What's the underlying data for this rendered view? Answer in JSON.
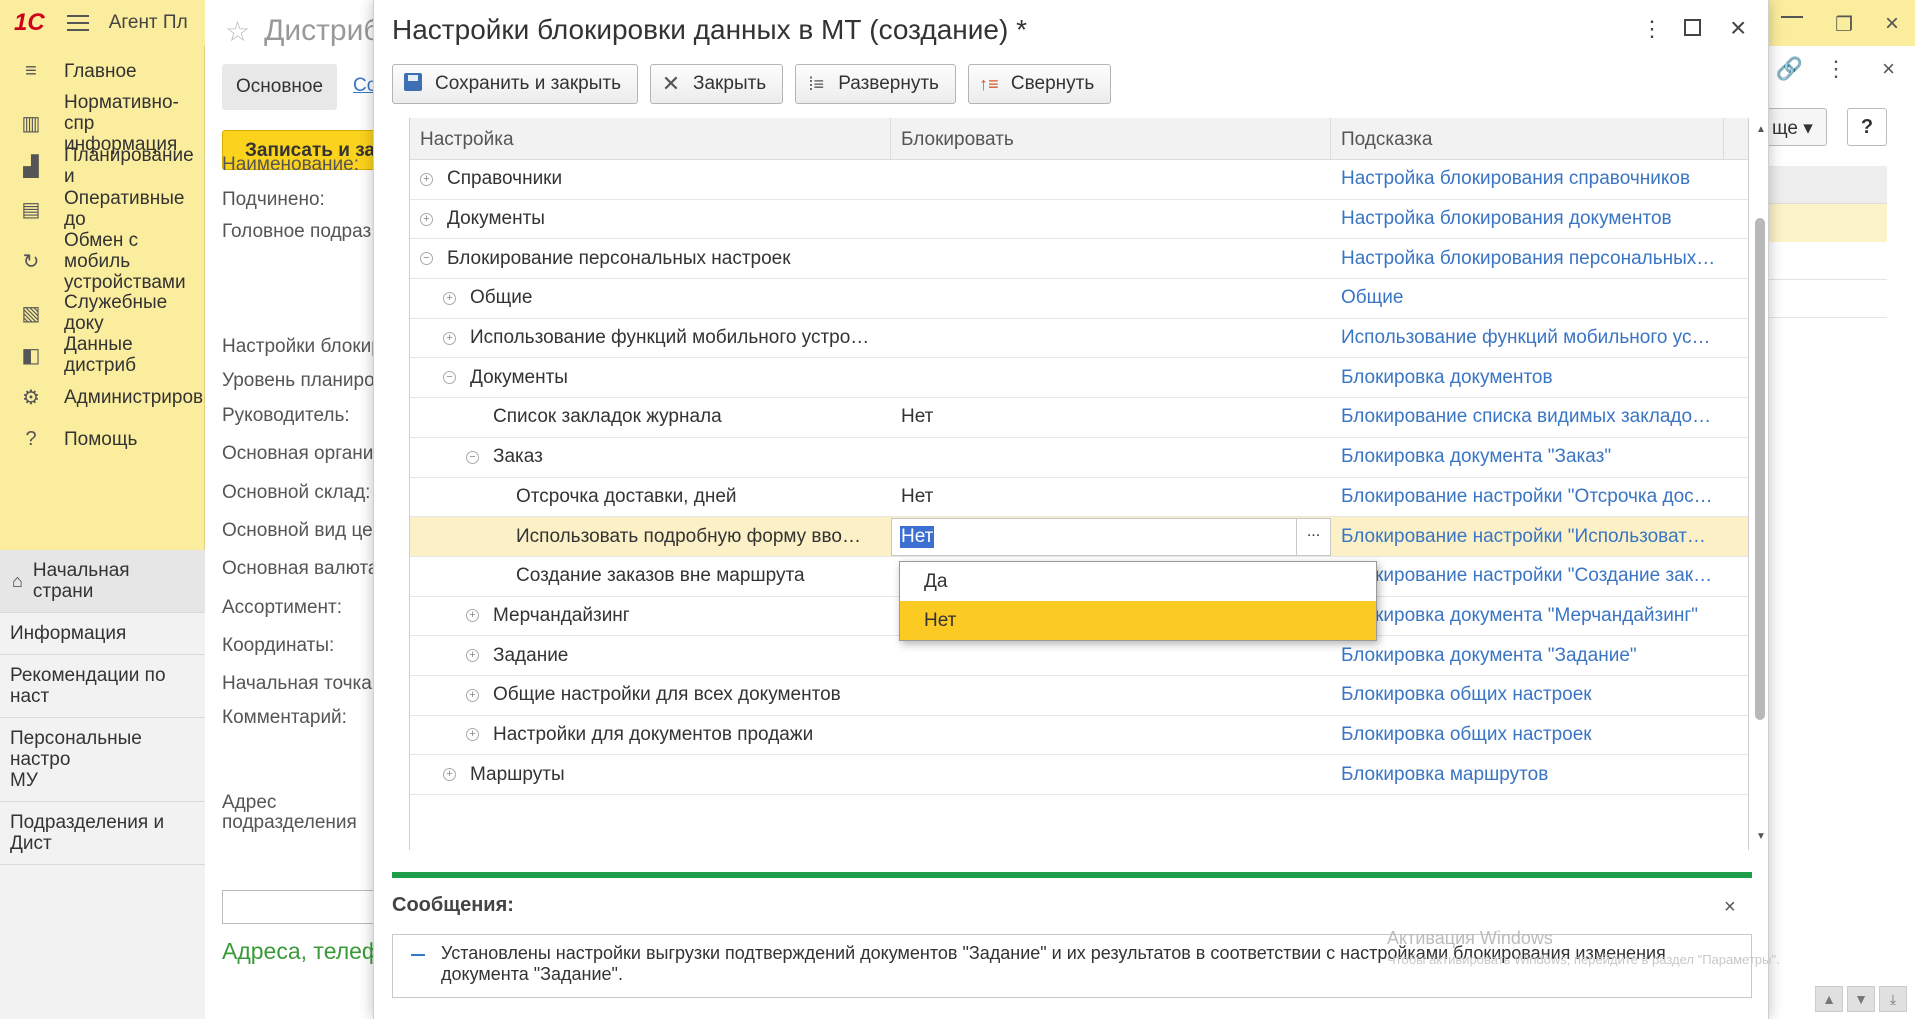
{
  "app": {
    "title": "Агент Пл",
    "sections": [
      {
        "icon": "≡",
        "label": "Главное"
      },
      {
        "icon": "▥",
        "label": "Нормативно-спр\nинформация"
      },
      {
        "icon": "▟",
        "label": "Планирование и"
      },
      {
        "icon": "▤",
        "label": "Оперативные до"
      },
      {
        "icon": "↻",
        "label": "Обмен с мобиль\nустройствами"
      },
      {
        "icon": "▧",
        "label": "Служебные доку"
      },
      {
        "icon": "◧",
        "label": "Данные дистриб"
      },
      {
        "icon": "⚙",
        "label": "Администриров"
      },
      {
        "icon": "?",
        "label": "Помощь"
      }
    ],
    "open_windows": [
      {
        "label": "Начальная страни"
      },
      {
        "label": "Информация"
      },
      {
        "label": "Рекомендации по наст"
      },
      {
        "label": "Персональные настро\nМУ"
      },
      {
        "label": "Подразделения и Дист"
      }
    ]
  },
  "bg_form": {
    "title": "Дистриб",
    "tab_main": "Основное",
    "tab_link": "Со",
    "write_button": "Записать и за",
    "fields": [
      "Наименование:",
      "Подчинено:",
      "Головное подраз",
      "Настройки блокир",
      "Уровень планиро",
      "Руководитель:",
      "Основная органи",
      "Основной склад:",
      "Основной вид це",
      "Основная валюта",
      "Ассортимент:",
      "Координаты:",
      "Начальная точка",
      "Комментарий:",
      "Адрес\nподразделения"
    ],
    "contacts_title": "Адреса, телеф",
    "more_button": "ще",
    "help_button": "?"
  },
  "dialog": {
    "title": "Настройки блокировки данных в МТ (создание) *",
    "toolbar": {
      "save_close": "Сохранить и закрыть",
      "close": "Закрыть",
      "expand": "Развернуть",
      "collapse": "Свернуть"
    },
    "columns": {
      "setting": "Настройка",
      "block": "Блокировать",
      "hint": "Подсказка"
    },
    "rows": [
      {
        "level": 0,
        "toggle": "+",
        "name": "Справочники",
        "value": "",
        "hint": "Настройка блокирования справочников"
      },
      {
        "level": 0,
        "toggle": "+",
        "name": "Документы",
        "value": "",
        "hint": "Настройка блокирования документов"
      },
      {
        "level": 0,
        "toggle": "−",
        "name": "Блокирование персональных настроек",
        "value": "",
        "hint": "Настройка блокирования персональных…"
      },
      {
        "level": 1,
        "toggle": "+",
        "name": "Общие",
        "value": "",
        "hint": "Общие"
      },
      {
        "level": 1,
        "toggle": "+",
        "name": "Использование функций мобильного устро…",
        "value": "",
        "hint": "Использование функций мобильного ус…"
      },
      {
        "level": 1,
        "toggle": "−",
        "name": "Документы",
        "value": "",
        "hint": "Блокировка документов"
      },
      {
        "level": 2,
        "toggle": "",
        "name": "Список закладок журнала",
        "value": "Нет",
        "hint": "Блокирование списка видимых закладо…"
      },
      {
        "level": 2,
        "toggle": "−",
        "name": "Заказ",
        "value": "",
        "hint": "Блокировка документа \"Заказ\""
      },
      {
        "level": 3,
        "toggle": "",
        "name": "Отсрочка доставки, дней",
        "value": "Нет",
        "hint": "Блокирование настройки \"Отсрочка дос…"
      },
      {
        "level": 3,
        "toggle": "",
        "name": "Использовать подробную форму вво…",
        "value": "Нет",
        "hint": "Блокирование настройки \"Использоват…",
        "selected": true
      },
      {
        "level": 3,
        "toggle": "",
        "name": "Создание заказов вне маршрута",
        "value": "",
        "hint": "Блокирование настройки \"Создание зак…"
      },
      {
        "level": 2,
        "toggle": "+",
        "name": "Мерчандайзинг",
        "value": "",
        "hint": "Блокировка документа \"Мерчандайзинг\""
      },
      {
        "level": 2,
        "toggle": "+",
        "name": "Задание",
        "value": "",
        "hint": "Блокировка документа \"Задание\""
      },
      {
        "level": 2,
        "toggle": "+",
        "name": "Общие настройки для всех документов",
        "value": "",
        "hint": "Блокировка общих настроек"
      },
      {
        "level": 2,
        "toggle": "+",
        "name": "Настройки для документов продажи",
        "value": "",
        "hint": "Блокировка общих настроек"
      },
      {
        "level": 1,
        "toggle": "+",
        "name": "Маршруты",
        "value": "",
        "hint": "Блокировка маршрутов"
      }
    ],
    "edit_value": "Нет",
    "edit_button": "...",
    "dropdown_options": [
      "Да",
      "Нет"
    ],
    "dropdown_selected": "Нет",
    "messages_title": "Сообщения:",
    "message_text": "Установлены настройки выгрузки подтверждений документов \"Задание\" и их результатов в соответствии с настройками блокирования изменения документа \"Задание\"."
  },
  "watermark": {
    "title": "Активация Windows",
    "subtitle": "Чтобы активировать Windows, перейдите в раздел \"Параметры\"."
  },
  "colors": {
    "sections_bg": "#fbed9e",
    "link": "#3a75c4",
    "selected_row": "#fcf1c6",
    "dropdown_highlight": "#fbcb24",
    "messages_line": "#1f9e4a"
  }
}
